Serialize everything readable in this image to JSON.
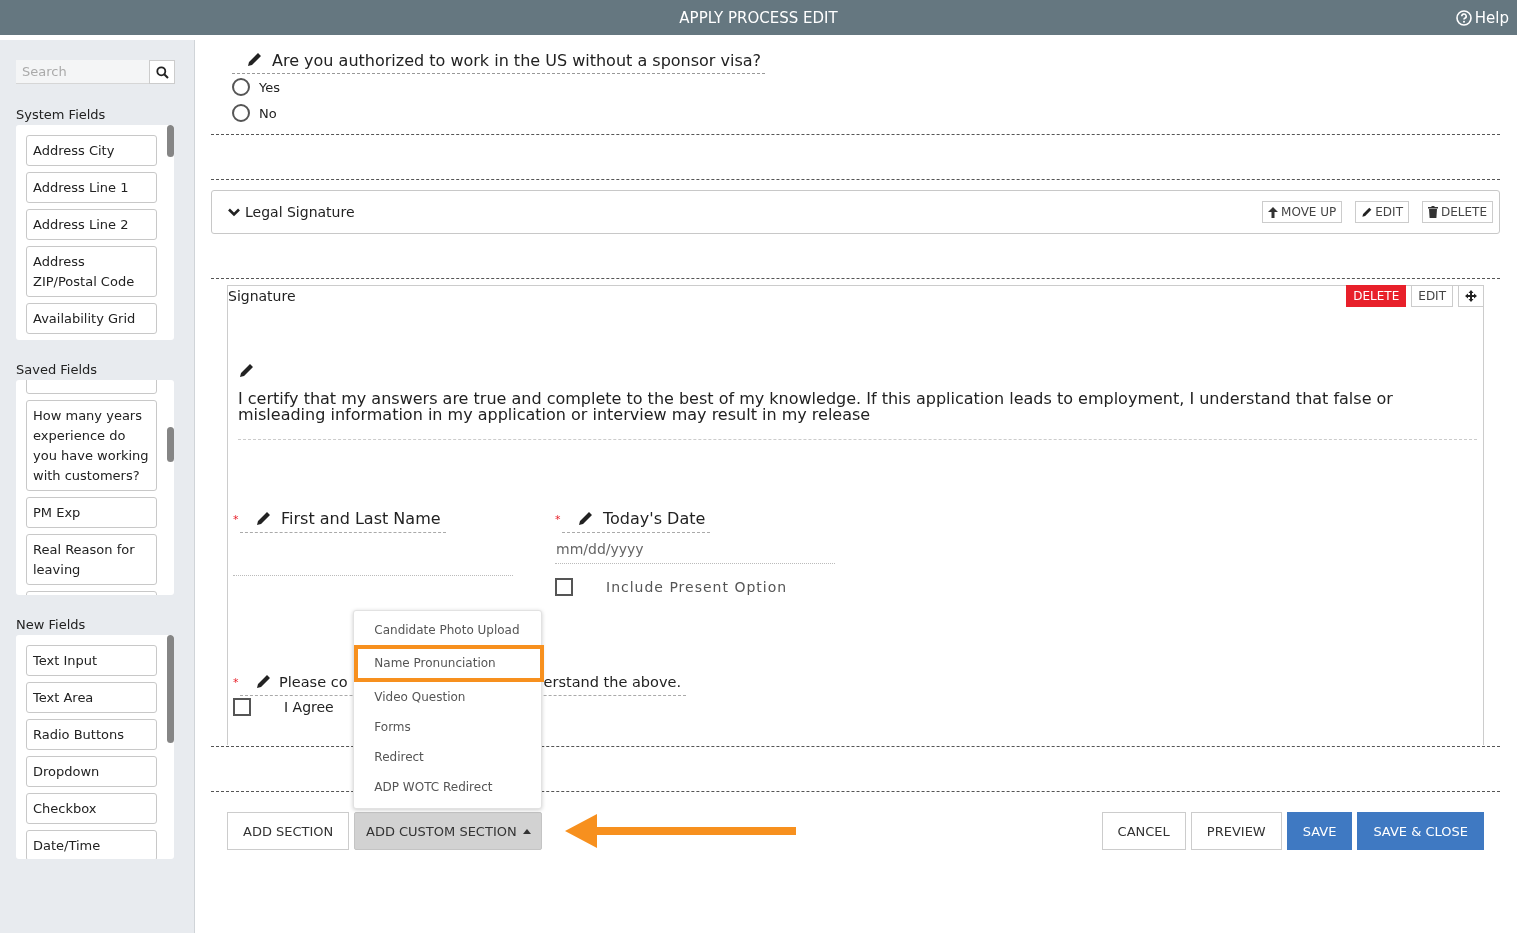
{
  "header": {
    "title": "APPLY PROCESS EDIT",
    "help": "Help"
  },
  "sidebar": {
    "search": {
      "placeholder": "Search"
    },
    "groups": [
      {
        "title": "System Fields",
        "clipped_above": false,
        "clipped_below": false,
        "items": [
          "Address City",
          "Address Line 1",
          "Address Line 2",
          "Address ZIP/Postal Code",
          "Availability Grid"
        ]
      },
      {
        "title": "Saved Fields",
        "clipped_above": true,
        "clipped_below": true,
        "items": [
          "How many years experience do you have working with customers?",
          "PM Exp",
          "Real Reason for leaving"
        ]
      },
      {
        "title": "New Fields",
        "clipped_above": false,
        "clipped_below": false,
        "items": [
          "Text Input",
          "Text Area",
          "Radio Buttons",
          "Dropdown",
          "Checkbox",
          "Date/Time"
        ]
      }
    ]
  },
  "question": {
    "label": "Are you authorized to work in the US without a sponsor visa?",
    "options": [
      {
        "label": "Yes",
        "selected": false
      },
      {
        "label": "No",
        "selected": false
      }
    ]
  },
  "section": {
    "title": "Legal Signature",
    "expanded": true,
    "actions": [
      {
        "label": "MOVE UP",
        "kind": "move-up"
      },
      {
        "label": "EDIT",
        "kind": "edit"
      },
      {
        "label": "DELETE",
        "kind": "delete"
      }
    ]
  },
  "signature_card": {
    "title": "Signature",
    "actions": [
      {
        "kind": "danger",
        "label": "DELETE"
      },
      {
        "kind": "plain",
        "label": "EDIT"
      },
      {
        "kind": "move"
      }
    ],
    "statement": "I certify that my answers are true and complete to the best of my knowledge. If this application leads to employment, I understand that false or misleading information in my application or interview may result in my release",
    "fields": [
      {
        "kind": "text",
        "label": "First and Last Name",
        "required_marker": "*"
      },
      {
        "kind": "date",
        "label": "Today's Date",
        "required_marker": "*",
        "placeholder": "mm/dd/yyyy",
        "option": {
          "label": "Include Present Option",
          "checked": false
        }
      }
    ],
    "consent": {
      "label_start": "Please co",
      "label_end": "erstand the above.",
      "required_marker": "*",
      "checkbox": {
        "label": "I Agree",
        "checked": false
      }
    }
  },
  "footer": {
    "left": [
      {
        "kind": "default",
        "label": "ADD SECTION"
      },
      {
        "kind": "dropdown",
        "label": "ADD CUSTOM SECTION",
        "expanded": true
      }
    ],
    "right": [
      {
        "kind": "default",
        "label": "CANCEL"
      },
      {
        "kind": "default",
        "label": "PREVIEW"
      },
      {
        "kind": "primary",
        "label": "SAVE"
      },
      {
        "kind": "primary",
        "label": "SAVE & CLOSE"
      }
    ],
    "annotation_arrow": true
  },
  "menu": {
    "items": [
      {
        "label": "Candidate Photo Upload",
        "highlighted": false
      },
      {
        "label": "Name Pronunciation",
        "highlighted": true
      },
      {
        "label": "Video Question",
        "highlighted": false
      },
      {
        "label": "Forms",
        "highlighted": false
      },
      {
        "label": "Redirect",
        "highlighted": false
      },
      {
        "label": "ADP WOTC Redirect",
        "highlighted": false
      }
    ]
  }
}
